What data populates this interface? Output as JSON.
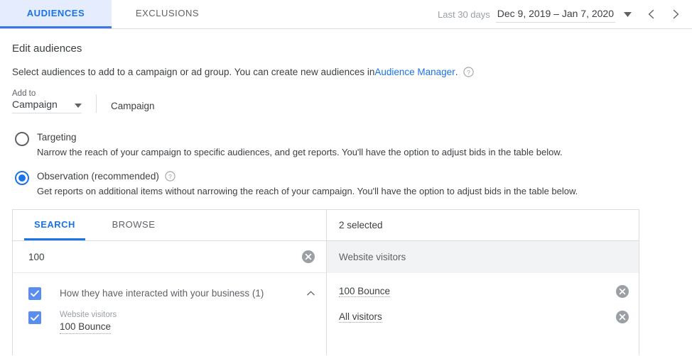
{
  "topbar": {
    "tabs": [
      {
        "label": "AUDIENCES",
        "active": true
      },
      {
        "label": "EXCLUSIONS",
        "active": false
      }
    ],
    "date_range": {
      "preset_label": "Last 30 days",
      "range_value": "Dec 9, 2019 – Jan 7, 2020",
      "caret_icon": "chevron-down-icon",
      "prev_icon": "chevron-left-icon",
      "next_icon": "chevron-right-icon"
    }
  },
  "page": {
    "title": "Edit audiences",
    "subtitle_before": "Select audiences to add to a campaign or ad group. You can create new audiences in ",
    "subtitle_link": "Audience Manager",
    "subtitle_after": ".",
    "help_icon": "help-circle-icon"
  },
  "add_to": {
    "label": "Add to",
    "selected": "Campaign",
    "caret_icon": "chevron-down-icon",
    "value": "Campaign"
  },
  "options": [
    {
      "title": "Targeting",
      "description": "Narrow the reach of your campaign to specific audiences, and get reports. You'll have the option to adjust bids in the table below.",
      "selected": false,
      "has_help": false
    },
    {
      "title": "Observation (recommended)",
      "description": "Get reports on additional items without narrowing the reach of your campaign. You'll have the option to adjust bids in the table below.",
      "selected": true,
      "has_help": true,
      "help_icon": "help-circle-icon"
    }
  ],
  "picker": {
    "tabs": [
      {
        "label": "SEARCH",
        "active": true
      },
      {
        "label": "BROWSE",
        "active": false
      }
    ],
    "search": {
      "value": "100",
      "placeholder": "Search",
      "clear_icon": "clear-circle-icon"
    },
    "results": {
      "group": {
        "label": "How they have interacted with your business (1)",
        "checked": true,
        "collapse_icon": "chevron-up-icon"
      },
      "items": [
        {
          "category": "Website visitors",
          "name": "100 Bounce",
          "checked": true
        }
      ]
    },
    "selected_panel": {
      "header": "2 selected",
      "group_label": "Website visitors",
      "items": [
        {
          "name": "100 Bounce",
          "remove_icon": "remove-circle-icon"
        },
        {
          "name": "All visitors",
          "remove_icon": "remove-circle-icon"
        }
      ]
    }
  },
  "colors": {
    "accent": "#1a73e8",
    "active_tab_bg": "#e4ecfd",
    "checkbox": "#5b8def",
    "group_bg": "#f1f3f4",
    "border": "#dadce0",
    "text": "#3c4043",
    "muted": "#5f6368"
  }
}
